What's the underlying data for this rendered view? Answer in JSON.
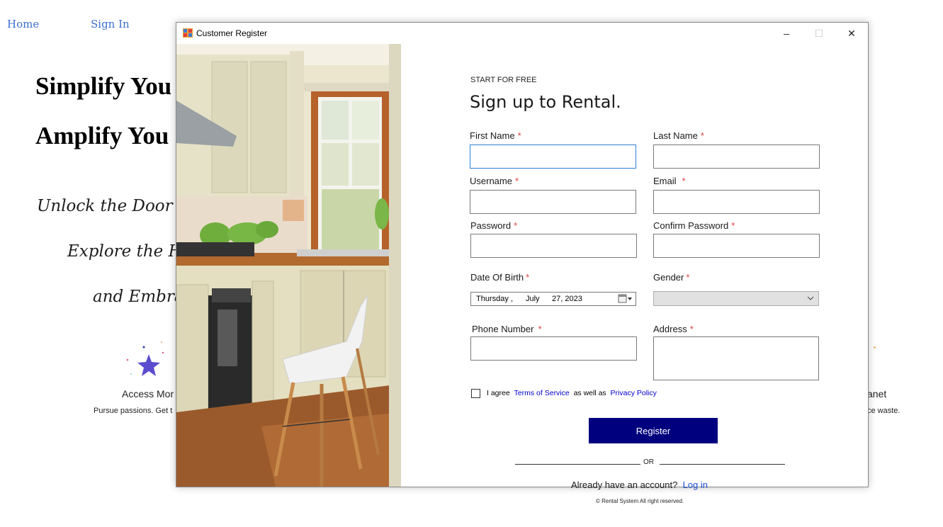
{
  "background_page": {
    "nav": {
      "home": "Home",
      "sign_in": "Sign In"
    },
    "headline_1": "Simplify You",
    "headline_2": "Amplify You",
    "tagline_1": "Unlock the Door to",
    "tagline_2": "Explore the Ho",
    "tagline_3": "and Embra",
    "feature_left_title": "Access Mor",
    "feature_left_desc": "Pursue passions. Get t",
    "feature_right_title": "anet",
    "feature_right_desc": "ce waste."
  },
  "window": {
    "title": "Customer Register",
    "minimize": "–",
    "maximize": "☐",
    "close": "✕"
  },
  "form": {
    "start_label": "START FOR FREE",
    "heading": "Sign up to Rental.",
    "required_mark": "*",
    "first_name_label": "First Name",
    "last_name_label": "Last Name",
    "username_label": "Username",
    "email_label": "Email",
    "password_label": "Password",
    "confirm_password_label": "Confirm Password",
    "dob_label": "Date Of Birth",
    "gender_label": "Gender",
    "phone_label": "Phone Number",
    "address_label": "Address",
    "dob_value": {
      "weekday": "Thursday",
      "sep": ",",
      "month": "July",
      "day_year": "27, 2023"
    },
    "gender_value": "",
    "agree_prefix": "I agree",
    "terms_link": "Terms of Service",
    "agree_middle": "as well as",
    "privacy_link": "Privacy Policy",
    "register_button": "Register",
    "or_text": "OR",
    "already_text": "Already have an account?",
    "login_link": "Log in",
    "copyright": "© Rental System All right reserved."
  }
}
